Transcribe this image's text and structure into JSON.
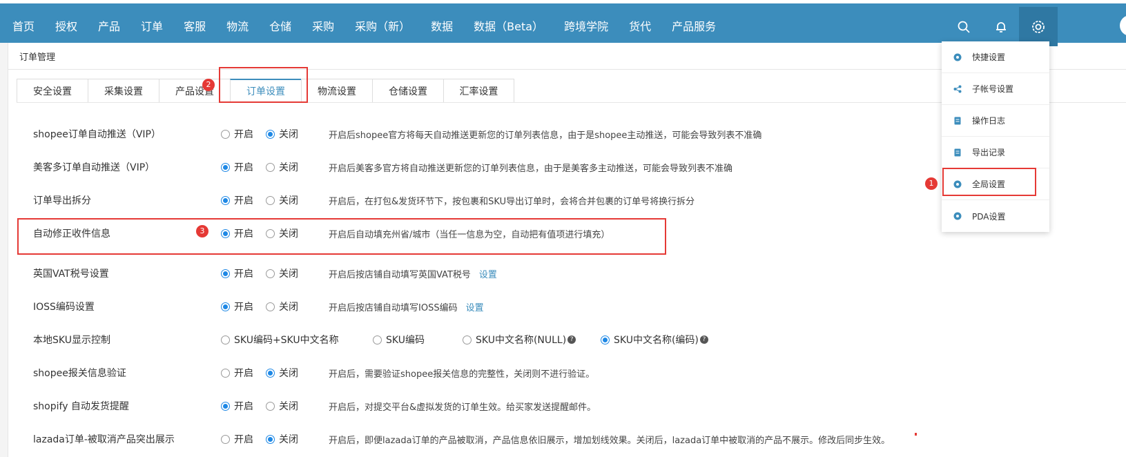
{
  "topnav": {
    "items": [
      "首页",
      "授权",
      "产品",
      "订单",
      "客服",
      "物流",
      "仓储",
      "采购",
      "采购（新）",
      "数据",
      "数据（Beta）",
      "跨境学院",
      "货代",
      "产品服务"
    ]
  },
  "breadcrumb": "订单管理",
  "tabs": [
    "安全设置",
    "采集设置",
    "产品设置",
    "订单设置",
    "物流设置",
    "仓储设置",
    "汇率设置"
  ],
  "radio_labels": {
    "on": "开启",
    "off": "关闭"
  },
  "settings": [
    {
      "label": "shopee订单自动推送（VIP）",
      "value": "off",
      "desc": "开启后shopee官方将每天自动推送更新您的订单列表信息，由于是shopee主动推送，可能会导致列表不准确"
    },
    {
      "label": "美客多订单自动推送（VIP）",
      "value": "on",
      "desc": "开启后美客多官方将自动推送更新您的订单列表信息，由于是美客多主动推送，可能会导致列表不准确"
    },
    {
      "label": "订单导出拆分",
      "value": "on",
      "desc": "开启后，在打包&发货环节下，按包裹和SKU导出订单时，会将合并包裹的订单号将换行拆分"
    },
    {
      "label": "自动修正收件信息",
      "value": "on",
      "desc": "开启后自动填充州省/城市（当任一信息为空，自动把有值项进行填充）"
    },
    {
      "label": "英国VAT税号设置",
      "value": "on",
      "desc": "开启后按店铺自动填写英国VAT税号",
      "link": "设置"
    },
    {
      "label": "IOSS编码设置",
      "value": "on",
      "desc": "开启后按店铺自动填写IOSS编码",
      "link": "设置"
    },
    {
      "label": "本地SKU显示控制",
      "sku_options": [
        "SKU编码+SKU中文名称",
        "SKU编码",
        "SKU中文名称(NULL)",
        "SKU中文名称(编码)"
      ],
      "sku_selected": 3
    },
    {
      "label": "shopee报关信息验证",
      "value": "off",
      "desc": "开启后，需要验证shopee报关信息的完整性，关闭则不进行验证。"
    },
    {
      "label": "shopify 自动发货提醒",
      "value": "on",
      "desc": "开启后，对提交平台&虚拟发货的订单生效。给买家发送提醒邮件。"
    },
    {
      "label": "lazada订单-被取消产品突出展示",
      "value": "off",
      "desc": "开启后，即便lazada订单的产品被取消，产品信息依旧展示，增加划线效果。关闭后，lazada订单中被取消的产品不展示。修改后同步生效。"
    }
  ],
  "dropdown": {
    "items": [
      {
        "label": "快捷设置",
        "icon": "gear-circle-icon"
      },
      {
        "label": "子帐号设置",
        "icon": "share-icon"
      },
      {
        "label": "操作日志",
        "icon": "document-icon"
      },
      {
        "label": "导出记录",
        "icon": "document-icon"
      },
      {
        "label": "全局设置",
        "icon": "gear-circle-icon"
      },
      {
        "label": "PDA设置",
        "icon": "gear-circle-icon"
      }
    ]
  },
  "badges": [
    "1",
    "2",
    "3"
  ],
  "colors": {
    "topbar": "#3c8dbc",
    "accent": "#1e88e5",
    "highlight": "#e53935"
  }
}
